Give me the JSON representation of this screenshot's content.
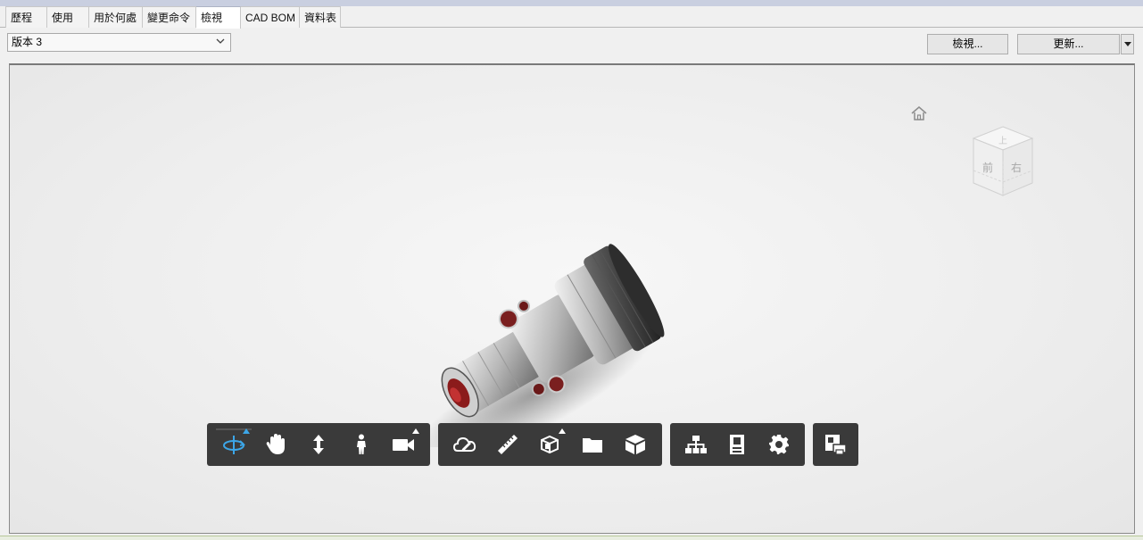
{
  "tabs": [
    {
      "label": "歷程"
    },
    {
      "label": "使用"
    },
    {
      "label": "用於何處"
    },
    {
      "label": "變更命令"
    },
    {
      "label": "檢視"
    },
    {
      "label": "CAD BOM"
    },
    {
      "label": "資料表"
    }
  ],
  "active_tab": "檢視",
  "version_select": {
    "value": "版本 3"
  },
  "buttons": {
    "view": "檢視...",
    "update": "更新..."
  },
  "viewcube": {
    "top": "上",
    "front": "前",
    "right": "右"
  },
  "toolbar": {
    "group1": [
      "orbit-icon",
      "pan-hand-icon",
      "zoom-icon",
      "walk-person-icon",
      "camera-icon"
    ],
    "group2": [
      "markup-cloud-icon",
      "measure-ruler-icon",
      "section-box-icon",
      "explode-folder-icon",
      "model-cube-icon"
    ],
    "group3": [
      "model-tree-icon",
      "properties-icon",
      "settings-gear-icon"
    ],
    "group4": [
      "print-export-icon"
    ],
    "active_tool": "orbit-icon",
    "icon_color": "#ffffff",
    "active_color": "#3ca6e8",
    "bar_color": "#3a3a3a"
  }
}
